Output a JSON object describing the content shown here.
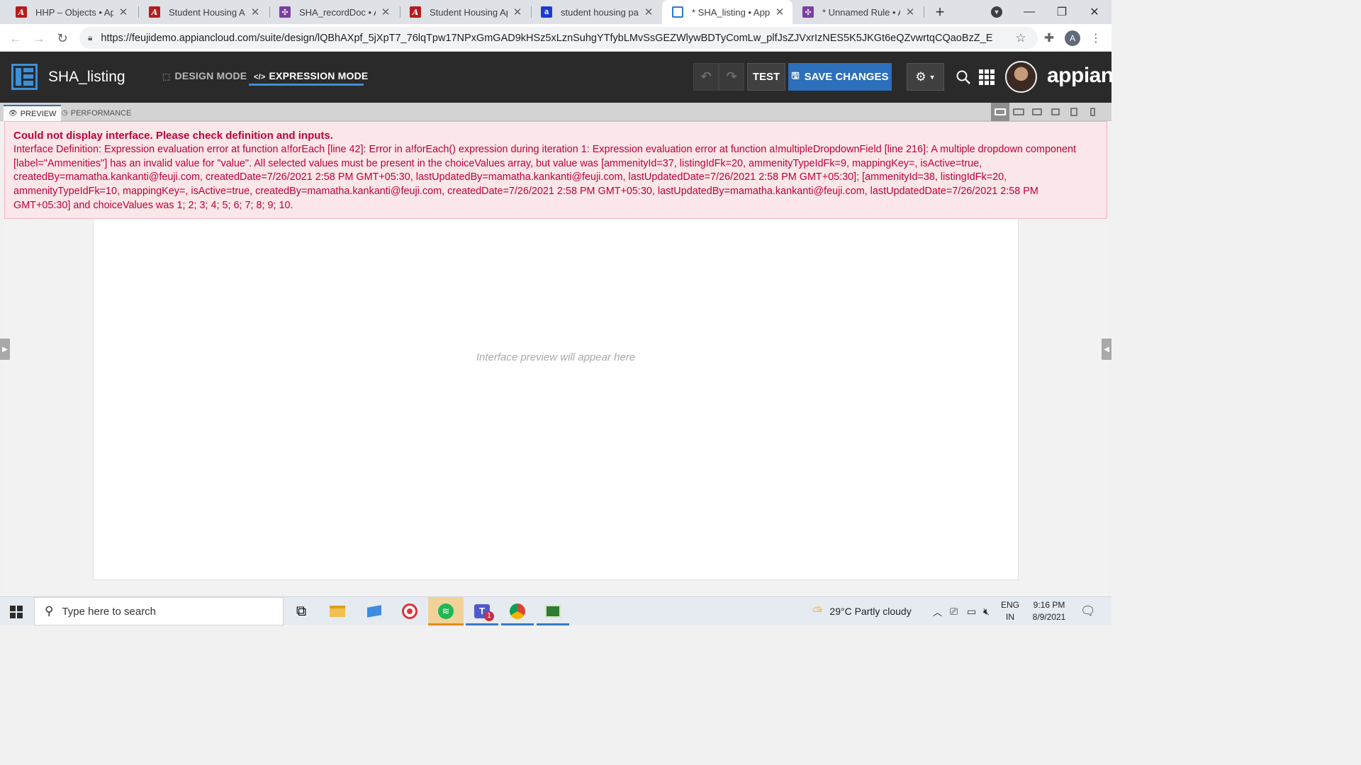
{
  "browser": {
    "tabs": [
      {
        "title": "HHP – Objects • Appia",
        "fav": "appian-a-icon"
      },
      {
        "title": "Student Housing App",
        "fav": "appian-a-icon"
      },
      {
        "title": "SHA_recordDoc • App",
        "fav": "appian-record-icon"
      },
      {
        "title": "Student Housing App",
        "fav": "appian-a-icon"
      },
      {
        "title": "student housing page",
        "fav": "blue-a-icon"
      },
      {
        "title": "* SHA_listing • Appian",
        "fav": "interface-icon"
      },
      {
        "title": "* Unnamed Rule • App",
        "fav": "appian-record-icon"
      }
    ],
    "new_tab_label": "+",
    "url": "https://feujidemo.appiancloud.com/suite/design/lQBhAXpf_5jXpT7_76lqTpw17NPxGmGAD9kHSz5xLznSuhgYTfybLMvSsGEZWlywBDTyComLw_plfJsZJVxrIzNES5K5JKGt6eQZvwrtqCQaoBzZ_E",
    "profile_initial": "A"
  },
  "app": {
    "name": "SHA_listing",
    "modes": {
      "design": "DESIGN MODE",
      "expression": "EXPRESSION MODE"
    },
    "test_label": "TEST",
    "save_label": "SAVE CHANGES",
    "brand": "appian"
  },
  "preview_tabs": {
    "preview": "PREVIEW",
    "performance": "PERFORMANCE"
  },
  "error": {
    "title": "Could not display interface. Please check definition and inputs.",
    "body": "Interface Definition: Expression evaluation error at function a!forEach [line 42]: Error in a!forEach() expression during iteration 1: Expression evaluation error at function a!multipleDropdownField [line 216]: A multiple dropdown component [label=\"Ammenities\"] has an invalid value for \"value\". All selected values must be present in the choiceValues array, but value was [ammenityId=37, listingIdFk=20, ammenityTypeIdFk=9, mappingKey=, isActive=true, createdBy=mamatha.kankanti@feuji.com, createdDate=7/26/2021 2:58 PM GMT+05:30, lastUpdatedBy=mamatha.kankanti@feuji.com, lastUpdatedDate=7/26/2021 2:58 PM GMT+05:30]; [ammenityId=38, listingIdFk=20, ammenityTypeIdFk=10, mappingKey=, isActive=true, createdBy=mamatha.kankanti@feuji.com, createdDate=7/26/2021 2:58 PM GMT+05:30, lastUpdatedBy=mamatha.kankanti@feuji.com, lastUpdatedDate=7/26/2021 2:58 PM GMT+05:30] and choiceValues was 1; 2; 3; 4; 5; 6; 7; 8; 9; 10."
  },
  "preview": {
    "placeholder": "Interface preview will appear here"
  },
  "taskbar": {
    "search_placeholder": "Type here to search",
    "weather": "29°C  Partly cloudy",
    "lang_top": "ENG",
    "lang_bottom": "IN",
    "time": "9:16 PM",
    "date": "8/9/2021",
    "teams_badge": "1"
  },
  "colors": {
    "accent": "#2c6fbb",
    "error_text": "#c1003a",
    "error_bg": "#fbe6e9",
    "header_bg": "#2a2a2a"
  }
}
